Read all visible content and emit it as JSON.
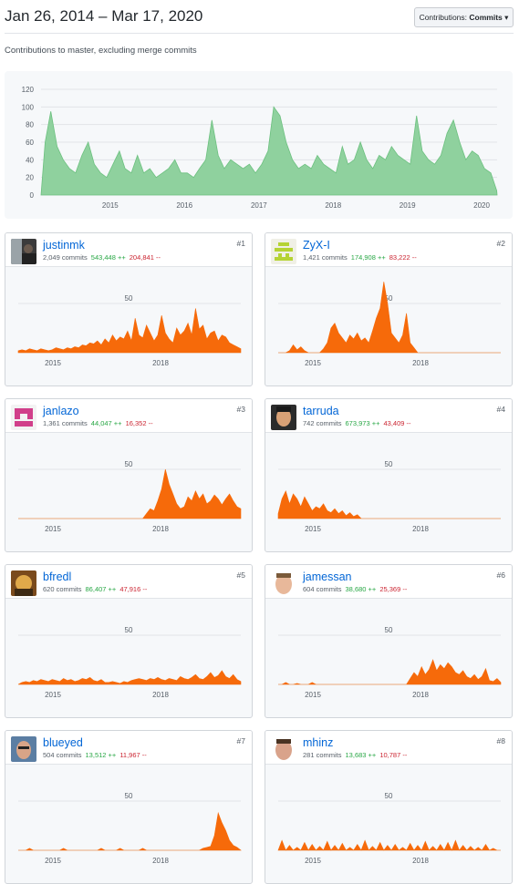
{
  "header": {
    "date_range": "Jan 26, 2014 – Mar 17, 2020",
    "contributions_label": "Contributions:",
    "contributions_value": "Commits",
    "caret": "▾"
  },
  "subtitle": "Contributions to master, excluding merge commits",
  "colors": {
    "overview_fill": "#8fd19e",
    "overview_stroke": "#6cc07f",
    "contributor_fill": "#f66a0a",
    "link": "#0366d6",
    "additions": "#28a745",
    "deletions": "#cb2431"
  },
  "chart_data": [
    {
      "type": "area",
      "name": "overview",
      "y_ticks": [
        "0",
        "20",
        "40",
        "60",
        "80",
        "100",
        "120"
      ],
      "ylim": [
        0,
        120
      ],
      "x_ticks": [
        "2015",
        "2016",
        "2017",
        "2018",
        "2019",
        "2020"
      ],
      "xlim": [
        "2014-01-26",
        "2020-03-17"
      ],
      "grid": true,
      "x": [
        "2014-02",
        "2014-03",
        "2014-04",
        "2014-05",
        "2014-06",
        "2014-07",
        "2014-08",
        "2014-09",
        "2014-10",
        "2014-11",
        "2014-12",
        "2015-01",
        "2015-02",
        "2015-03",
        "2015-04",
        "2015-05",
        "2015-06",
        "2015-07",
        "2015-08",
        "2015-09",
        "2015-10",
        "2015-11",
        "2015-12",
        "2016-01",
        "2016-02",
        "2016-03",
        "2016-04",
        "2016-05",
        "2016-06",
        "2016-07",
        "2016-08",
        "2016-09",
        "2016-10",
        "2016-11",
        "2016-12",
        "2017-01",
        "2017-02",
        "2017-03",
        "2017-04",
        "2017-05",
        "2017-06",
        "2017-07",
        "2017-08",
        "2017-09",
        "2017-10",
        "2017-11",
        "2017-12",
        "2018-01",
        "2018-02",
        "2018-03",
        "2018-04",
        "2018-05",
        "2018-06",
        "2018-07",
        "2018-08",
        "2018-09",
        "2018-10",
        "2018-11",
        "2018-12",
        "2019-01",
        "2019-02",
        "2019-03",
        "2019-04",
        "2019-05",
        "2019-06",
        "2019-07",
        "2019-08",
        "2019-09",
        "2019-10",
        "2019-11",
        "2019-12",
        "2020-01",
        "2020-02",
        "2020-03"
      ],
      "values": [
        60,
        95,
        55,
        40,
        30,
        25,
        45,
        60,
        35,
        25,
        20,
        35,
        50,
        30,
        25,
        45,
        25,
        30,
        20,
        25,
        30,
        40,
        25,
        25,
        20,
        30,
        40,
        85,
        45,
        30,
        40,
        35,
        30,
        35,
        25,
        35,
        50,
        100,
        90,
        60,
        40,
        30,
        35,
        30,
        45,
        35,
        30,
        25,
        55,
        35,
        40,
        60,
        40,
        30,
        45,
        40,
        55,
        45,
        40,
        35,
        90,
        50,
        40,
        35,
        45,
        70,
        85,
        60,
        40,
        50,
        45,
        30,
        25,
        5
      ]
    },
    {
      "type": "area",
      "name": "justinmk",
      "y_tick": "50",
      "x_ticks": [
        "2015",
        "2018"
      ],
      "values": [
        2,
        3,
        2,
        4,
        3,
        2,
        4,
        3,
        2,
        3,
        5,
        4,
        3,
        5,
        4,
        6,
        5,
        8,
        7,
        10,
        9,
        12,
        8,
        14,
        10,
        18,
        12,
        16,
        14,
        22,
        12,
        35,
        18,
        15,
        28,
        20,
        12,
        18,
        38,
        20,
        14,
        10,
        25,
        18,
        22,
        30,
        18,
        45,
        24,
        28,
        14,
        20,
        22,
        12,
        18,
        16,
        10,
        8,
        6,
        4
      ]
    },
    {
      "type": "area",
      "name": "ZyX-I",
      "y_tick": "50",
      "x_ticks": [
        "2015",
        "2018"
      ],
      "values": [
        0,
        0,
        0,
        2,
        8,
        3,
        6,
        2,
        0,
        0,
        0,
        0,
        4,
        10,
        25,
        30,
        20,
        15,
        10,
        18,
        14,
        20,
        12,
        15,
        10,
        22,
        35,
        45,
        72,
        50,
        20,
        15,
        10,
        18,
        40,
        10,
        5,
        0,
        0,
        0,
        0,
        0,
        0,
        0,
        0,
        0,
        0,
        0,
        0,
        0,
        0,
        0,
        0,
        0,
        0,
        0,
        0,
        0,
        0,
        0
      ]
    },
    {
      "type": "area",
      "name": "janlazo",
      "y_tick": "50",
      "x_ticks": [
        "2015",
        "2018"
      ],
      "values": [
        0,
        0,
        0,
        0,
        0,
        0,
        0,
        0,
        0,
        0,
        0,
        0,
        0,
        0,
        0,
        0,
        0,
        0,
        0,
        0,
        0,
        0,
        0,
        0,
        0,
        0,
        0,
        0,
        0,
        0,
        0,
        0,
        0,
        0,
        5,
        10,
        8,
        18,
        30,
        50,
        35,
        25,
        15,
        10,
        12,
        22,
        18,
        28,
        20,
        25,
        15,
        18,
        24,
        20,
        14,
        20,
        25,
        18,
        12,
        10
      ]
    },
    {
      "type": "area",
      "name": "tarruda",
      "y_tick": "50",
      "x_ticks": [
        "2015",
        "2018"
      ],
      "values": [
        5,
        20,
        28,
        15,
        25,
        20,
        12,
        22,
        15,
        8,
        12,
        10,
        15,
        8,
        6,
        10,
        5,
        8,
        3,
        6,
        2,
        4,
        0,
        0,
        0,
        0,
        0,
        0,
        0,
        0,
        0,
        0,
        0,
        0,
        0,
        0,
        0,
        0,
        0,
        0,
        0,
        0,
        0,
        0,
        0,
        0,
        0,
        0,
        0,
        0,
        0,
        0,
        0,
        0,
        0,
        0,
        0,
        0,
        0,
        0
      ]
    },
    {
      "type": "area",
      "name": "bfredl",
      "y_tick": "50",
      "x_ticks": [
        "2015",
        "2018"
      ],
      "values": [
        0,
        2,
        3,
        2,
        4,
        3,
        5,
        4,
        3,
        5,
        4,
        3,
        6,
        4,
        5,
        3,
        4,
        6,
        5,
        7,
        4,
        3,
        5,
        2,
        2,
        3,
        2,
        1,
        3,
        2,
        4,
        5,
        6,
        5,
        4,
        6,
        5,
        7,
        5,
        4,
        6,
        5,
        4,
        8,
        6,
        5,
        7,
        10,
        6,
        5,
        8,
        12,
        7,
        9,
        14,
        8,
        6,
        10,
        5,
        3
      ]
    },
    {
      "type": "area",
      "name": "jamessan",
      "y_tick": "50",
      "x_ticks": [
        "2015",
        "2018"
      ],
      "values": [
        0,
        0,
        2,
        0,
        0,
        1,
        0,
        0,
        0,
        2,
        0,
        0,
        0,
        0,
        0,
        0,
        0,
        0,
        0,
        0,
        0,
        0,
        0,
        0,
        0,
        0,
        0,
        0,
        0,
        0,
        0,
        0,
        0,
        0,
        0,
        6,
        12,
        8,
        18,
        10,
        15,
        25,
        14,
        20,
        16,
        22,
        18,
        12,
        10,
        14,
        8,
        6,
        10,
        5,
        8,
        16,
        4,
        3,
        6,
        2
      ]
    },
    {
      "type": "area",
      "name": "blueyed",
      "y_tick": "50",
      "x_ticks": [
        "2015",
        "2018"
      ],
      "values": [
        0,
        0,
        0,
        2,
        0,
        0,
        0,
        0,
        0,
        0,
        0,
        0,
        2,
        0,
        0,
        0,
        0,
        0,
        0,
        0,
        0,
        0,
        2,
        0,
        0,
        0,
        0,
        2,
        0,
        0,
        0,
        0,
        0,
        2,
        0,
        0,
        0,
        0,
        0,
        0,
        0,
        0,
        0,
        0,
        0,
        0,
        0,
        0,
        0,
        2,
        3,
        4,
        15,
        38,
        28,
        20,
        10,
        5,
        3,
        0
      ]
    },
    {
      "type": "area",
      "name": "mhinz",
      "y_tick": "50",
      "x_ticks": [
        "2015",
        "2018"
      ],
      "values": [
        0,
        10,
        0,
        5,
        0,
        3,
        0,
        8,
        0,
        6,
        0,
        4,
        0,
        9,
        0,
        5,
        0,
        7,
        0,
        3,
        0,
        6,
        0,
        10,
        0,
        4,
        0,
        8,
        0,
        5,
        0,
        6,
        0,
        3,
        0,
        7,
        0,
        5,
        0,
        9,
        0,
        4,
        0,
        6,
        0,
        8,
        0,
        10,
        0,
        5,
        0,
        4,
        0,
        3,
        0,
        6,
        0,
        2,
        0,
        0
      ]
    }
  ],
  "contributors": [
    {
      "name": "justinmk",
      "rank": "#1",
      "commits": "2,049 commits",
      "additions": "543,448 ++",
      "deletions": "204,841 --"
    },
    {
      "name": "ZyX-I",
      "rank": "#2",
      "commits": "1,421 commits",
      "additions": "174,908 ++",
      "deletions": "83,222 --"
    },
    {
      "name": "janlazo",
      "rank": "#3",
      "commits": "1,361 commits",
      "additions": "44,047 ++",
      "deletions": "16,352 --"
    },
    {
      "name": "tarruda",
      "rank": "#4",
      "commits": "742 commits",
      "additions": "673,973 ++",
      "deletions": "43,409 --"
    },
    {
      "name": "bfredl",
      "rank": "#5",
      "commits": "620 commits",
      "additions": "86,407 ++",
      "deletions": "47,916 --"
    },
    {
      "name": "jamessan",
      "rank": "#6",
      "commits": "604 commits",
      "additions": "38,680 ++",
      "deletions": "25,369 --"
    },
    {
      "name": "blueyed",
      "rank": "#7",
      "commits": "504 commits",
      "additions": "13,512 ++",
      "deletions": "11,967 --"
    },
    {
      "name": "mhinz",
      "rank": "#8",
      "commits": "281 commits",
      "additions": "13,683 ++",
      "deletions": "10,787 --"
    }
  ]
}
